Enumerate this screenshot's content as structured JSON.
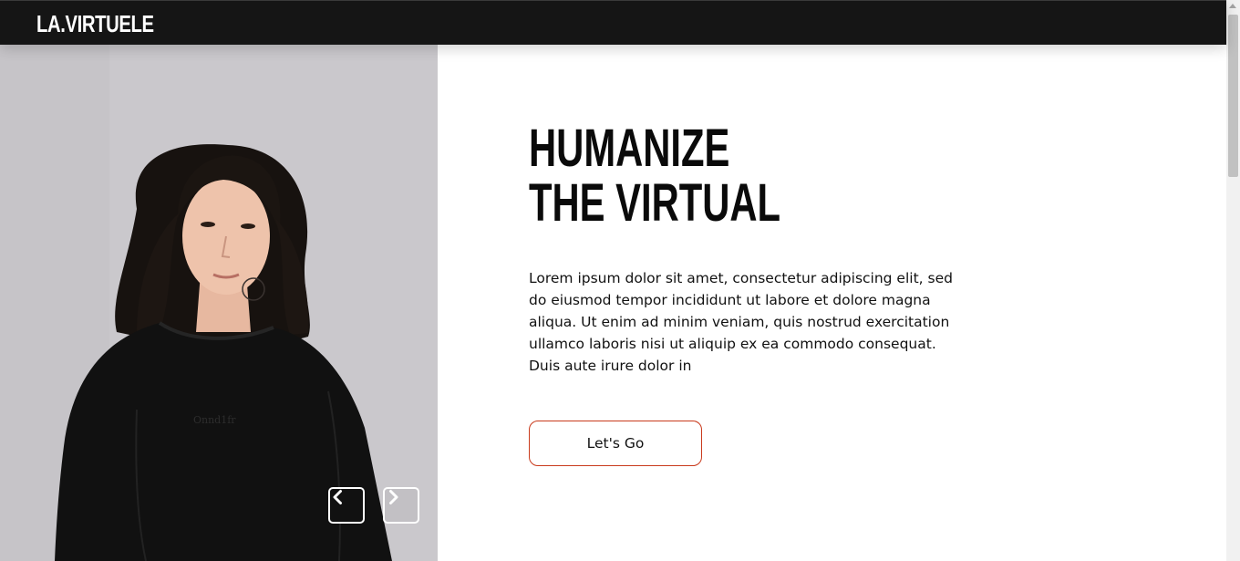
{
  "brand": {
    "logo_text": "LA.VIRTUELE"
  },
  "hero": {
    "headline_line1": "HUMANIZE",
    "headline_line2": "THE VIRTUAL",
    "body": "Lorem ipsum dolor sit amet, consectetur adipiscing elit, sed do eiusmod tempor incididunt ut labore et dolore magna aliqua. Ut enim ad minim veniam, quis nostrud exercitation ullamco laboris nisi ut aliquip ex ea commodo consequat. Duis aute irure dolor in",
    "cta_label": "Let's Go",
    "shirt_print": "Onnd1fr"
  },
  "slider": {
    "prev_icon": "chevron-left-icon",
    "next_icon": "chevron-right-icon"
  },
  "colors": {
    "navbar_bg": "#151515",
    "cta_border": "#c93a1c",
    "photo_bg": "#c9c7cb"
  }
}
